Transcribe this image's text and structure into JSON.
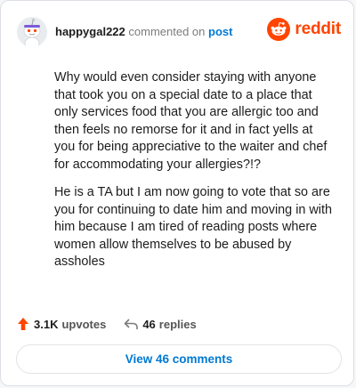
{
  "comment": {
    "username": "happygal222",
    "action_text": "commented on",
    "target": "post",
    "paragraphs": [
      "Why would even consider staying with anyone that took you on a special date to a place that only services food that you are allergic too and then feels no remorse for it and in fact yells at you for being appreciative to the waiter and chef for accommodating your allergies?!?",
      "He is a TA but I am now going to vote that so are you for continuing to date him and moving in with him because I am tired of reading posts where women allow themselves to be abused by assholes"
    ]
  },
  "brand": {
    "name": "reddit",
    "color": "#ff4500"
  },
  "stats": {
    "upvotes_count": "3.1K",
    "upvotes_label": "upvotes",
    "replies_count": "46",
    "replies_label": "replies"
  },
  "view_button": {
    "label": "View 46 comments"
  },
  "icons": {
    "avatar": "snoo-avatar-icon",
    "logo": "reddit-logo-icon",
    "upvote": "upvote-arrow-icon",
    "reply": "reply-arrow-icon"
  }
}
